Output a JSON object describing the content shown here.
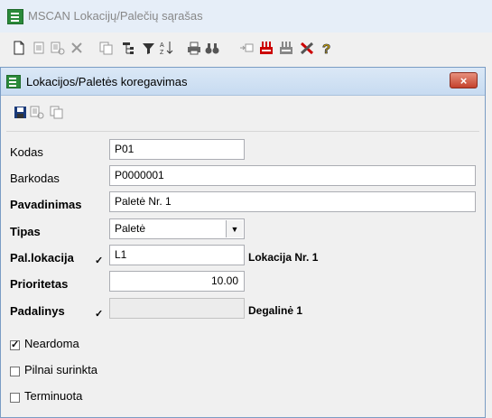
{
  "app": {
    "title": "MSCAN Lokacijų/Palečių sąrašas",
    "toolbar_icons": [
      "new-document-icon",
      "copy-icon",
      "properties-icon",
      "delete-icon",
      "paste-icon",
      "tree-icon",
      "filter-icon",
      "sort-icon",
      "print-icon",
      "find-icon",
      "export-icon",
      "delivery-icon",
      "import-icon",
      "tools-cross-icon",
      "help-icon"
    ]
  },
  "dialog": {
    "title": "Lokacijos/Paletės koregavimas",
    "close_label": "×",
    "toolbar_icons": [
      "save-icon",
      "properties-icon",
      "copy-icon"
    ]
  },
  "form": {
    "kodas": {
      "label": "Kodas",
      "value": "P01"
    },
    "barkodas": {
      "label": "Barkodas",
      "value": "P0000001"
    },
    "pavadinimas": {
      "label": "Pavadinimas",
      "value": "Paletė Nr. 1"
    },
    "tipas": {
      "label": "Tipas",
      "value": "Paletė"
    },
    "pal_lokacija": {
      "label": "Pal.lokacija",
      "value": "L1",
      "description": "Lokacija Nr. 1"
    },
    "prioritetas": {
      "label": "Prioritetas",
      "value": "10.00"
    },
    "padalinys": {
      "label": "Padalinys",
      "value": "",
      "description": "Degalinė 1"
    },
    "neardoma": {
      "label": "Neardoma",
      "checked": true
    },
    "pilnai_surinkta": {
      "label": "Pilnai surinkta",
      "checked": false
    },
    "terminuota": {
      "label": "Terminuota",
      "checked": false
    }
  }
}
